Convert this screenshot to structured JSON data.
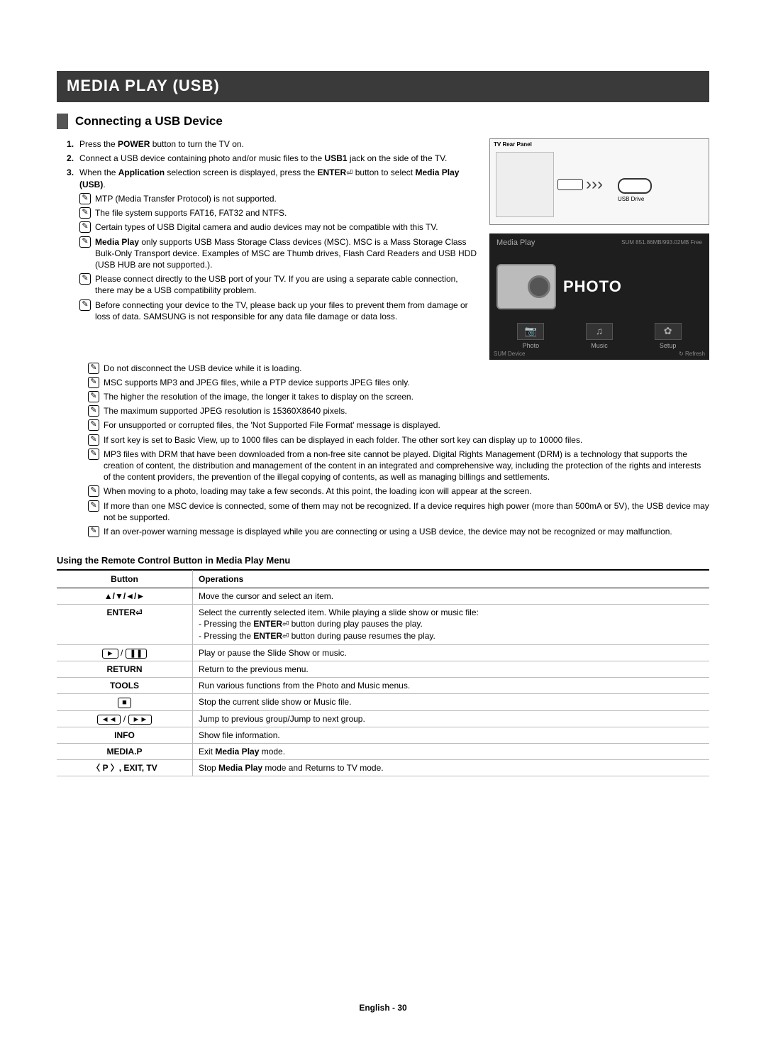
{
  "chapter": "MEDIA PLAY (USB)",
  "section_title": "Connecting a USB Device",
  "step1_a": "Press the ",
  "step1_b": "POWER",
  "step1_c": " button to turn the TV on.",
  "step2_a": "Connect a USB device containing photo and/or music files to the ",
  "step2_b": "USB1",
  "step2_c": " jack on the side of the TV.",
  "step3_a": "When the ",
  "step3_b": "Application",
  "step3_c": " selection screen is displayed, press the ",
  "step3_d": "ENTER",
  "step3_e": " button to select ",
  "step3_f": "Media Play (USB)",
  "step3_g": ".",
  "notes_narrow": [
    "MTP (Media Transfer Protocol) is not supported.",
    "The file system supports FAT16, FAT32 and NTFS.",
    "Certain types of USB Digital camera and audio devices may not be compatible with this TV."
  ],
  "note_msc_a": "Media Play",
  "note_msc_b": " only supports USB Mass Storage Class devices (MSC). MSC is a Mass Storage Class Bulk-Only Transport device. Examples of MSC are Thumb drives, Flash Card Readers and USB HDD (USB HUB are not supported.).",
  "notes_narrow2": [
    "Please connect directly to the USB port of your TV. If you are using a separate cable connection, there may be a USB compatibility problem.",
    "Before connecting your device to the TV, please back up your files to prevent them from damage or loss of data. SAMSUNG is not responsible for any data file damage or data loss."
  ],
  "notes_wide": [
    "Do not disconnect the USB device while it is loading.",
    "MSC supports MP3 and JPEG files, while a PTP device supports JPEG files only.",
    "The higher the resolution of the image, the longer it takes to display on the screen.",
    "The maximum supported JPEG resolution is 15360X8640 pixels.",
    "For unsupported or corrupted files, the 'Not Supported File Format' message is displayed.",
    "If sort key is set to Basic View, up to 1000 files can be displayed in each folder. The other sort key can display up to 10000 files.",
    "MP3 files with DRM that have been downloaded from a non-free site cannot be played. Digital Rights Management (DRM) is a technology that supports the creation of content, the distribution and management of the content in an integrated and comprehensive way, including the protection of the rights and interests of the content providers, the prevention of the illegal copying of contents, as well as managing billings and settlements.",
    "When moving to a photo, loading may take a few seconds. At this point, the loading icon will appear at the screen.",
    "If more than one MSC device is connected, some of them may not be recognized. If a device requires high power (more than 500mA or 5V), the USB device may not be supported.",
    "If an over-power warning message is displayed while you are connecting or using a USB device, the device may not be recognized or may malfunction."
  ],
  "rear_panel_label": "TV Rear Panel",
  "usb_drive_label": "USB Drive",
  "mp": {
    "title": "Media Play",
    "sum": "SUM    851.86MB/993.02MB Free",
    "big": "PHOTO",
    "thumbs": [
      {
        "icon": "📷",
        "label": "Photo"
      },
      {
        "icon": "♫",
        "label": "Music"
      },
      {
        "icon": "✿",
        "label": "Setup"
      }
    ],
    "foot_left": "SUM    Device",
    "foot_right": "↻ Refresh"
  },
  "table_title": "Using the Remote Control Button in Media Play Menu",
  "table_headers": [
    "Button",
    "Operations"
  ],
  "rc_rows": {
    "r1_btn": "▲/▼/◄/►",
    "r1_op": "Move the cursor and select an item.",
    "r2_btn": "ENTER",
    "r2_op_a": "Select the currently selected item. While playing a slide show or music file:",
    "r2_op_b": "- Pressing the ",
    "r2_op_c": "ENTER",
    "r2_op_d": " button during play pauses the play.",
    "r2_op_e": "- Pressing the ",
    "r2_op_f": "ENTER",
    "r2_op_g": " button during pause resumes the play.",
    "r3_op": "Play or pause the Slide Show or music.",
    "r4_btn": "RETURN",
    "r4_op": "Return to the previous menu.",
    "r5_btn": "TOOLS",
    "r5_op": "Run various functions from the Photo and Music menus.",
    "r6_op": "Stop the current slide show or Music file.",
    "r7_op": "Jump to previous group/Jump to next group.",
    "r8_btn": "INFO",
    "r8_op": "Show file information.",
    "r9_btn": "MEDIA.P",
    "r9_op_a": "Exit ",
    "r9_op_b": "Media Play",
    "r9_op_c": " mode.",
    "r10_btn": "〈 P 〉, EXIT, TV",
    "r10_op_a": "Stop ",
    "r10_op_b": "Media Play",
    "r10_op_c": " mode and Returns to TV mode."
  },
  "footer": "English - 30"
}
